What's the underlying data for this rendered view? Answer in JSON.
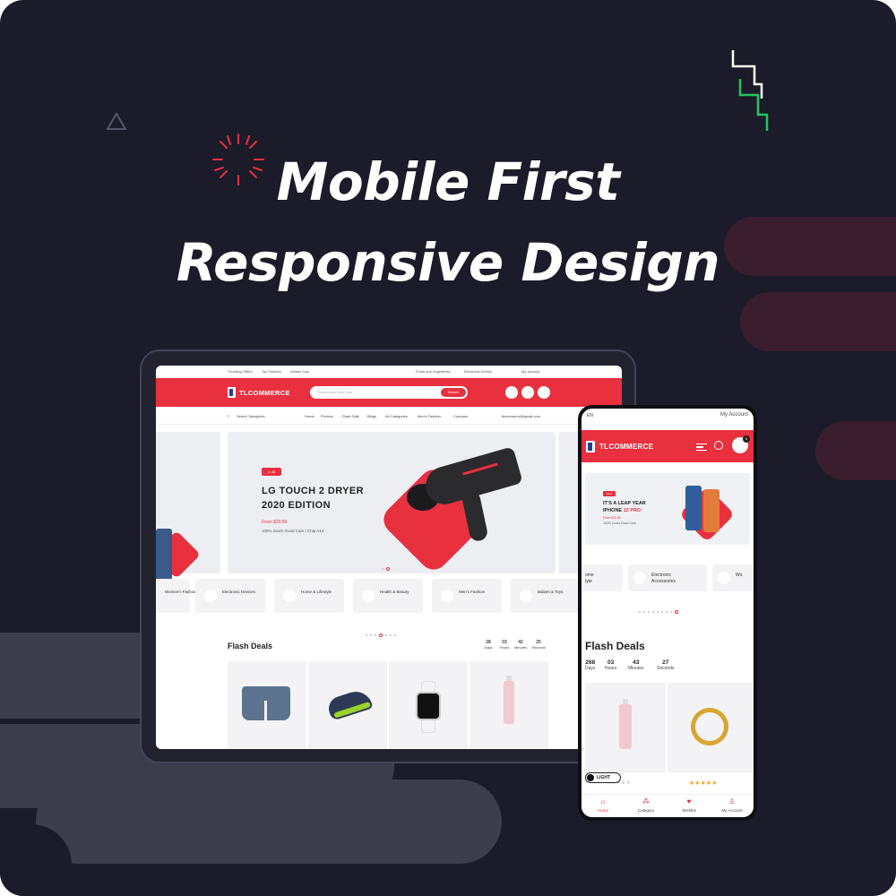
{
  "headline": {
    "line1": "Mobile First",
    "line2": "Responsive Design"
  },
  "colors": {
    "background": "#1b1b29",
    "accent": "#e8303f",
    "accent_dark": "#3a1e2e",
    "grey_shape": "#3d3d4e"
  },
  "tablet": {
    "topbar": {
      "links": [
        "Trending Offers",
        "Top Fashion",
        "Adidas Gay",
        "Fruits and Vegetables",
        "Electronic Device",
        "My account"
      ]
    },
    "header": {
      "logo": "TLCOMMERCE",
      "search_placeholder": "Search your item here",
      "search_button": "Search"
    },
    "nav": {
      "category": "Select Categories",
      "links": [
        "Home",
        "Product",
        "Flash Sale",
        "Blogs",
        "All Categories",
        "Men's Fashion",
        "Compare"
      ],
      "email": "tlcommerce@gmail.com"
    },
    "hero": {
      "tag": "•• 40",
      "title_line1": "LG TOUCH 2 DRYER",
      "title_line2": "2020 EDITION",
      "price": "From $20.56",
      "subtitle": "100% Zoom Good Cam | Chip A14"
    },
    "categories": [
      {
        "label": "Women's Fashion",
        "icon": "dress-icon"
      },
      {
        "label": "Electronic Devices",
        "icon": "device-icon"
      },
      {
        "label": "Home & Lifestyle",
        "icon": "lamp-icon"
      },
      {
        "label": "Health & Beauty",
        "icon": "bottle-icon"
      },
      {
        "label": "Men's Fashion",
        "icon": "shirt-icon"
      },
      {
        "label": "Babies & Toys",
        "icon": "toy-icon"
      }
    ],
    "flash": {
      "title": "Flash Deals",
      "timer": [
        {
          "value": "28",
          "unit": "Days"
        },
        {
          "value": "03",
          "unit": "Hours"
        },
        {
          "value": "42",
          "unit": "Minutes"
        },
        {
          "value": "25",
          "unit": "Seconds"
        }
      ],
      "products": [
        "jeans-shorts",
        "running-shoe",
        "smart-watch",
        "perfume-bottle"
      ]
    }
  },
  "phone": {
    "top": {
      "language": "EN",
      "account": "My Account"
    },
    "header": {
      "logo": "TLCOMMERCE",
      "cart_count": "0"
    },
    "hero": {
      "tag": "New",
      "title_line1": "IT'S A LEAP YEAR",
      "title_line2_plain": "IPHONE",
      "title_line2_red": "12 PRO",
      "price": "From $20.56",
      "subtitle": "100% Zoom Good Cam"
    },
    "categories": [
      {
        "label_line1": "ome",
        "label_line2": "tyle"
      },
      {
        "label_line1": "Electronic",
        "label_line2": "Accessories"
      },
      {
        "label_line1": "Wo",
        "label_line2": ""
      }
    ],
    "flash": {
      "title": "Flash Deals",
      "timer": [
        {
          "value": "268",
          "unit": "Days"
        },
        {
          "value": "03",
          "unit": "Hours"
        },
        {
          "value": "43",
          "unit": "Minutes"
        },
        {
          "value": "27",
          "unit": "Seconds"
        }
      ],
      "rating_filled": "★★★★★",
      "rating_empty": "★★★★★",
      "theme_toggle": "LIGHT"
    },
    "tabbar": [
      {
        "label": "Home",
        "icon": "home-icon"
      },
      {
        "label": "Category",
        "icon": "category-icon"
      },
      {
        "label": "Wishlist",
        "icon": "heart-icon"
      },
      {
        "label": "My Account",
        "icon": "user-icon"
      }
    ]
  }
}
